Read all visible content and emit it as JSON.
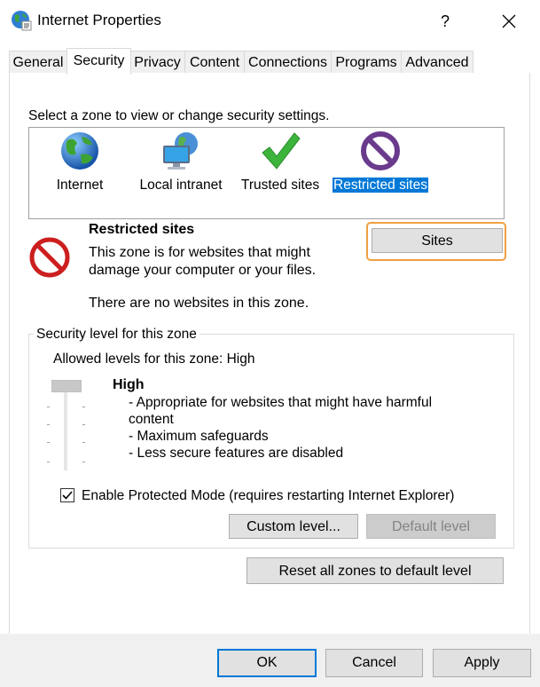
{
  "window": {
    "title": "Internet Properties",
    "help_glyph": "?",
    "close_glyph": "✕"
  },
  "tabs": [
    {
      "label": "General"
    },
    {
      "label": "Security"
    },
    {
      "label": "Privacy"
    },
    {
      "label": "Content"
    },
    {
      "label": "Connections"
    },
    {
      "label": "Programs"
    },
    {
      "label": "Advanced"
    }
  ],
  "active_tab": "Security",
  "security": {
    "select_zone_text": "Select a zone to view or change security settings.",
    "zones": [
      {
        "label": "Internet",
        "icon": "globe-icon"
      },
      {
        "label": "Local intranet",
        "icon": "intranet-icon"
      },
      {
        "label": "Trusted sites",
        "icon": "checkmark-icon"
      },
      {
        "label": "Restricted sites",
        "icon": "restricted-icon"
      }
    ],
    "selected_zone": "Restricted sites",
    "zone_title": "Restricted sites",
    "zone_description_line1": "This zone is for websites that might",
    "zone_description_line2": "damage your computer or your files.",
    "zone_status": "There are no websites in this zone.",
    "sites_button": "Sites",
    "level_group_title": "Security level for this zone",
    "allowed_levels": "Allowed levels for this zone: High",
    "level_name": "High",
    "level_items": [
      "- Appropriate for websites that might have harmful",
      "content",
      "- Maximum safeguards",
      "- Less secure features are disabled"
    ],
    "slider_level": "High",
    "protected_mode_label": "Enable Protected Mode (requires restarting Internet Explorer)",
    "protected_mode_checked": true,
    "custom_level_button": "Custom level...",
    "default_level_button": "Default level",
    "reset_all_button": "Reset all zones to default level"
  },
  "footer": {
    "ok": "OK",
    "cancel": "Cancel",
    "apply": "Apply"
  },
  "colors": {
    "selection": "#0078d7",
    "focus_ring": "#f0a040",
    "restricted_red": "#cc1f1f"
  }
}
